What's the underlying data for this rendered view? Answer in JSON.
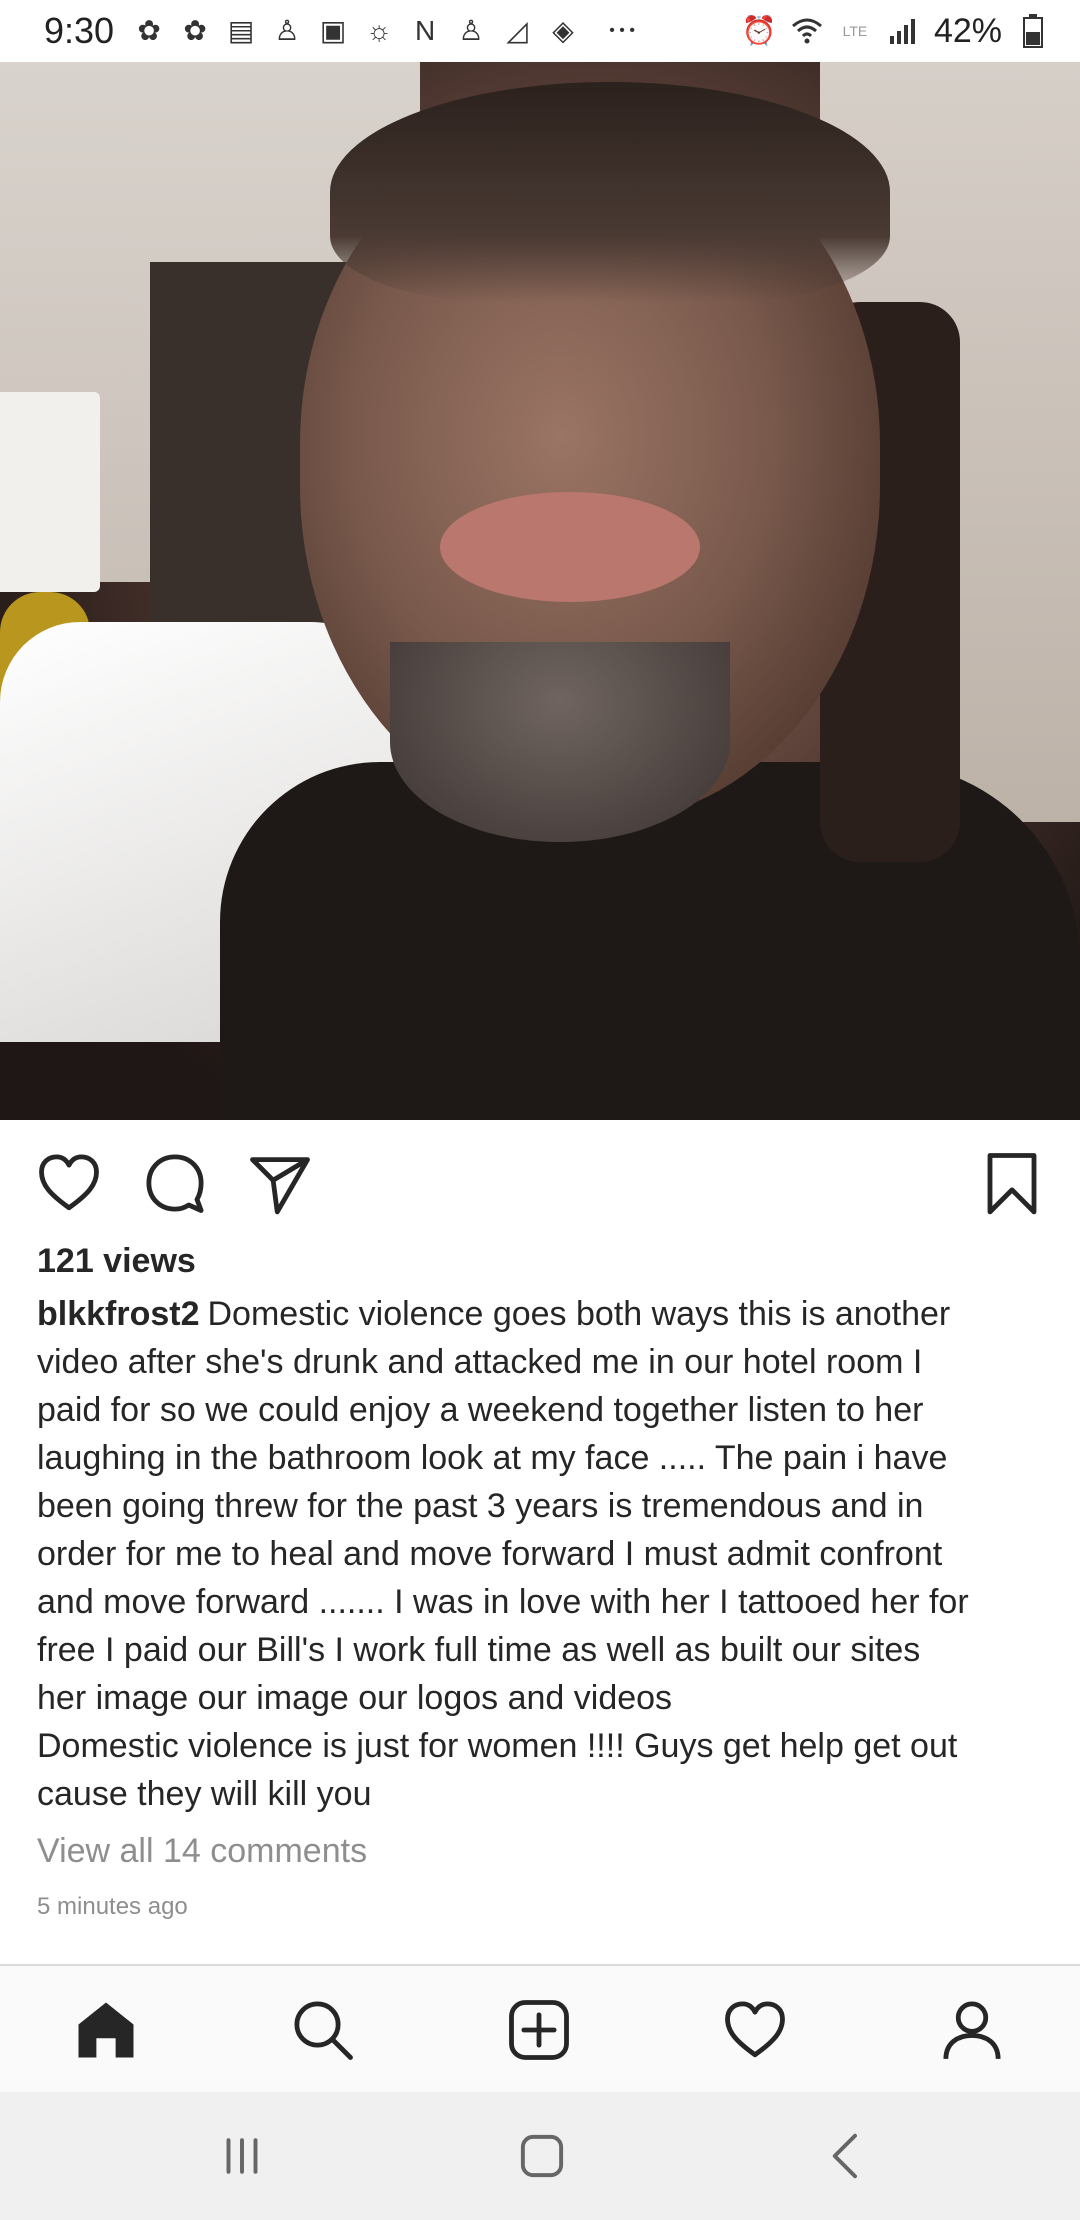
{
  "status_bar": {
    "time": "9:30",
    "battery": "42%",
    "icons": [
      "app-icon",
      "app-icon",
      "news-icon",
      "alert-icon",
      "adp-icon",
      "weather-icon",
      "netflix-icon",
      "alert-icon",
      "chart-icon",
      "tag-icon",
      "more-icon",
      "alarm-icon",
      "wifi-icon",
      "lte-icon",
      "signal-icon",
      "battery-icon"
    ],
    "more_glyph": "• • •"
  },
  "post": {
    "image_alt": "Video frame of man with swollen lip in hotel room",
    "views": "121 views",
    "username": "blkkfrost2",
    "caption_lines": [
      "Domestic violence goes both ways this is another",
      "video after she's drunk and attacked me in our hotel room I",
      "paid for so we could enjoy a weekend together listen to her",
      "laughing in the bathroom look at my face ..... The pain i have",
      "been going threw for the past 3 years is tremendous and in",
      "order for me to heal and move forward I must admit confront",
      "and move forward ....... I was in love with her I tattooed her for",
      "free I paid our Bill's I work full time as well as built our sites",
      "her image our image our logos and videos",
      "Domestic violence is just for women !!!! Guys get help get out",
      "cause they will kill you"
    ],
    "comments_link": "View all 14 comments",
    "time_ago": "5 minutes ago"
  },
  "actions": {
    "like": "heart-icon",
    "comment": "comment-icon",
    "share": "send-icon",
    "save": "bookmark-icon"
  },
  "tabbar": {
    "items": [
      "home-icon",
      "search-icon",
      "add-post-icon",
      "activity-heart-icon",
      "profile-icon"
    ]
  },
  "colors": {
    "text": "#262626",
    "muted": "#8e8e8e",
    "tabbar_bg": "#fafafa",
    "sysnav_bg": "#f0f0f0"
  }
}
